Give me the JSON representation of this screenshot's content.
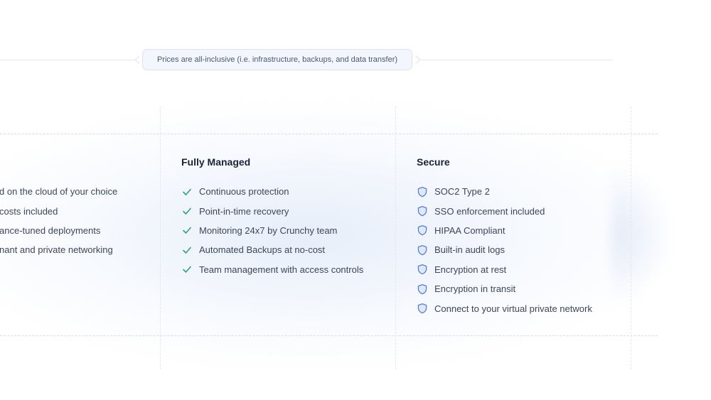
{
  "notice": {
    "text": "Prices are all-inclusive (i.e. infrastructure, backups, and data transfer)"
  },
  "columns": [
    {
      "title": "",
      "items": [
        "d on the cloud of your choice",
        " costs included",
        "ance-tuned deployments",
        "nant and private networking"
      ]
    },
    {
      "title": "Fully Managed",
      "icon": "check-icon",
      "icon_color": "#2fa37a",
      "items": [
        "Continuous protection",
        "Point-in-time recovery",
        "Monitoring 24x7 by Crunchy team",
        "Automated Backups at no-cost",
        "Team management with access controls"
      ]
    },
    {
      "title": "Secure",
      "icon": "shield-icon",
      "icon_color": "#5b7fc9",
      "items": [
        "SOC2 Type 2",
        "SSO enforcement included",
        "HIPAA Compliant",
        "Built-in audit logs",
        "Encryption at rest",
        "Encryption in transit",
        "Connect to your virtual private network"
      ]
    }
  ]
}
